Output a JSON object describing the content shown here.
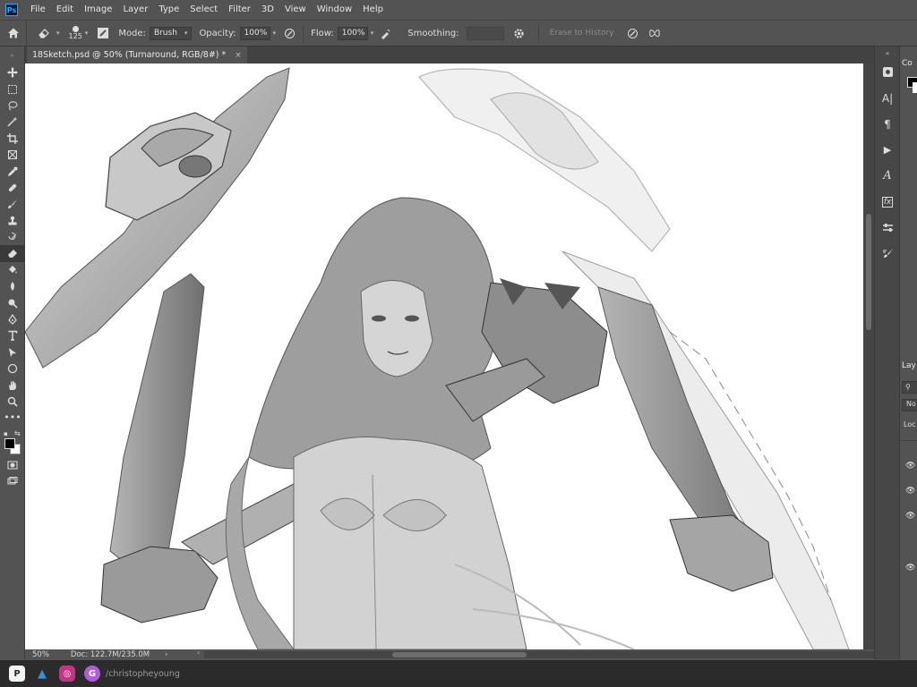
{
  "app": {
    "logo_text": "Ps"
  },
  "menu": [
    "File",
    "Edit",
    "Image",
    "Layer",
    "Type",
    "Select",
    "Filter",
    "3D",
    "View",
    "Window",
    "Help"
  ],
  "options": {
    "brush_size": "125",
    "mode_label": "Mode:",
    "mode_value": "Brush",
    "opacity_label": "Opacity:",
    "opacity_value": "100%",
    "flow_label": "Flow:",
    "flow_value": "100%",
    "smoothing_label": "Smoothing:",
    "erase_history_label": "Erase to History"
  },
  "document": {
    "tab_title": "18Sketch.psd @ 50% (Turnaround, RGB/8#) *",
    "close_glyph": "×"
  },
  "status": {
    "zoom": "50%",
    "doc_info": "Doc: 122.7M/235.0M"
  },
  "panels": {
    "color_tab": "Co",
    "layers_tab": "Lay",
    "blend_mode": "No",
    "lock_label": "Loc"
  },
  "tools": [
    "move-icon",
    "marquee-icon",
    "lasso-icon",
    "magic-wand-icon",
    "crop-icon",
    "frame-icon",
    "eyedropper-icon",
    "healing-icon",
    "brush-icon",
    "clone-stamp-icon",
    "history-brush-icon",
    "eraser-icon",
    "gradient-icon",
    "blur-icon",
    "dodge-icon",
    "pen-icon",
    "type-icon",
    "path-select-icon",
    "shape-icon",
    "hand-icon",
    "zoom-icon",
    "more-tools-icon"
  ],
  "dock_icons": [
    "panel-toggle-icon",
    "character-icon",
    "paragraph-icon",
    "actions-icon",
    "glyphs-icon",
    "styles-icon",
    "adjustments-icon",
    "brush-settings-icon"
  ],
  "social": {
    "handle": "/christopheyoung"
  },
  "colors": {
    "ui_bg": "#535353",
    "accent": "#31a8ff"
  }
}
